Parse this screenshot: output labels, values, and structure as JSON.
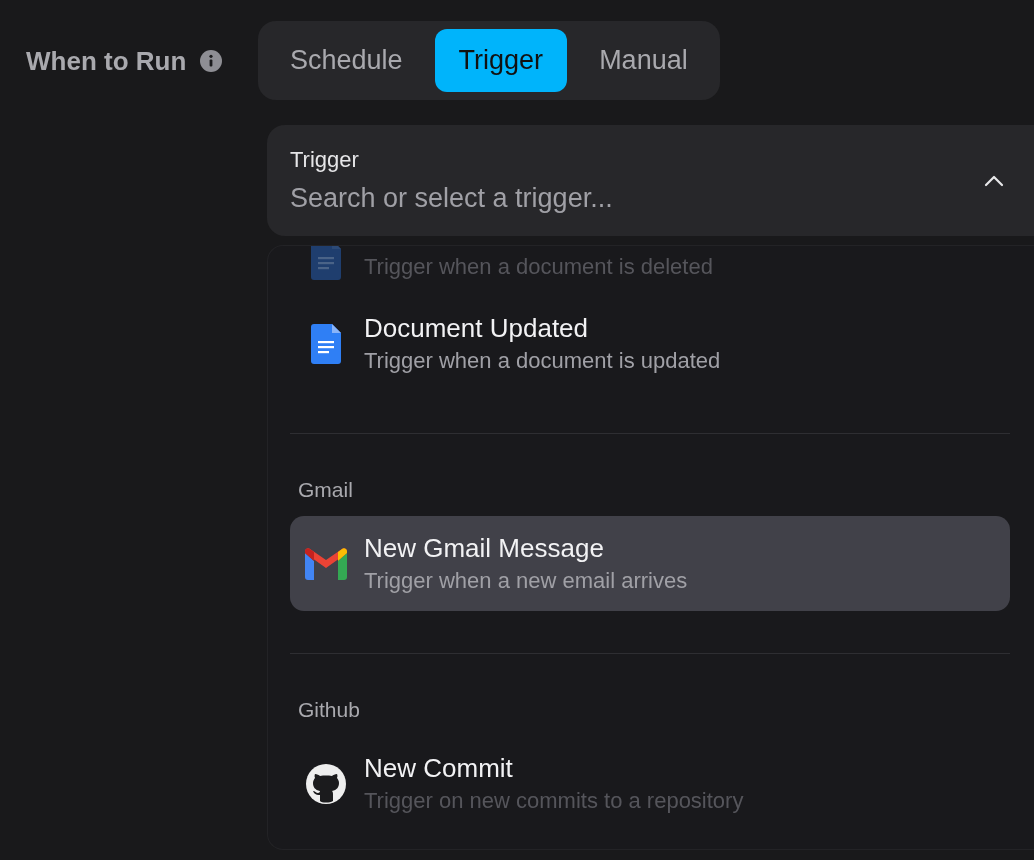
{
  "field_label": "When to Run",
  "modes": [
    {
      "label": "Schedule",
      "selected": false
    },
    {
      "label": "Trigger",
      "selected": true
    },
    {
      "label": "Manual",
      "selected": false
    }
  ],
  "trigger": {
    "label": "Trigger",
    "placeholder": "Search or select a trigger...",
    "expanded": true
  },
  "groups": [
    {
      "items": [
        {
          "kind": "document",
          "description": "Trigger when a document is deleted",
          "dimmed": true,
          "selected": false
        },
        {
          "kind": "document",
          "title": "Document Updated",
          "description": "Trigger when a document is updated",
          "dimmed": false,
          "selected": false
        }
      ]
    },
    {
      "title": "Gmail",
      "items": [
        {
          "kind": "email",
          "title": "New Gmail Message",
          "description": "Trigger when a new email arrives",
          "dimmed": false,
          "selected": true
        }
      ]
    },
    {
      "title": "Github",
      "items": [
        {
          "kind": "repository",
          "title": "New Commit",
          "description": "Trigger on new commits to a repository",
          "dimmed": true,
          "selected": false
        }
      ]
    }
  ]
}
